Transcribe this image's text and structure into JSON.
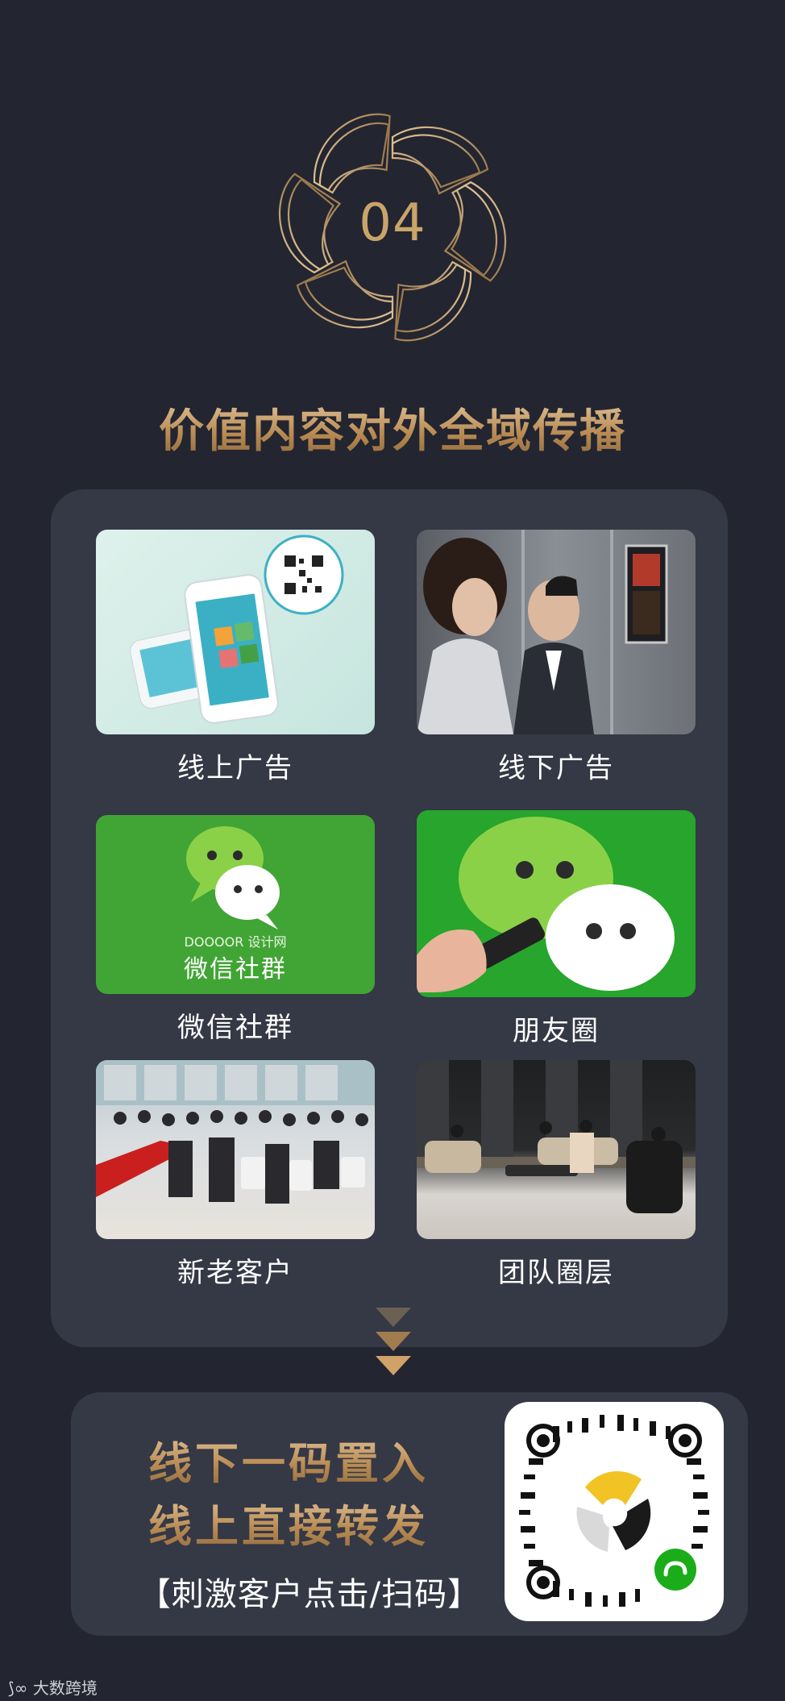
{
  "badge": {
    "number": "04"
  },
  "title": "价值内容对外全域传播",
  "items": [
    {
      "label": "线上广告"
    },
    {
      "label": "线下广告"
    },
    {
      "label": "微信社群",
      "overlay_brand": "DOOOOR 设计网",
      "overlay_text": "微信社群"
    },
    {
      "label": "朋友圈"
    },
    {
      "label": "新老客户"
    },
    {
      "label": "团队圈层"
    }
  ],
  "cta": {
    "line1": "线下一码置入",
    "line2": "线上直接转发",
    "line3": "【刺激客户点击/扫码】"
  },
  "footer": {
    "text": "大数跨境"
  },
  "colors": {
    "background": "#232530",
    "panel": "#353845",
    "gold": "#c7a170",
    "wechat_green": "#3aa830"
  }
}
